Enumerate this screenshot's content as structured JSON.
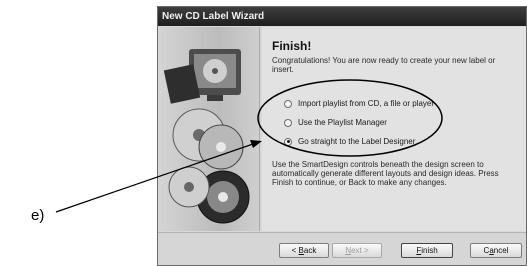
{
  "figure_label": "e)",
  "window": {
    "title": "New CD Label Wizard"
  },
  "content": {
    "heading": "Finish!",
    "intro": "Congratulations! You are now ready to create your new label or insert.",
    "options": [
      {
        "label": "Import playlist from CD, a file or player",
        "selected": false
      },
      {
        "label": "Use the Playlist Manager",
        "selected": false
      },
      {
        "label": "Go straight to the Label Designer",
        "selected": true
      }
    ],
    "description": "Use the SmartDesign controls beneath the design screen to automatically generate different layouts and design ideas. Press Finish to continue, or Back to make any changes."
  },
  "buttons": {
    "back": {
      "prefix": "< ",
      "mnemonic": "B",
      "rest": "ack"
    },
    "next": {
      "mnemonic": "N",
      "rest": "ext >"
    },
    "finish": {
      "mnemonic": "F",
      "rest": "inish"
    },
    "cancel": {
      "prefix": "C",
      "mnemonic": "a",
      "rest": "ncel"
    }
  }
}
